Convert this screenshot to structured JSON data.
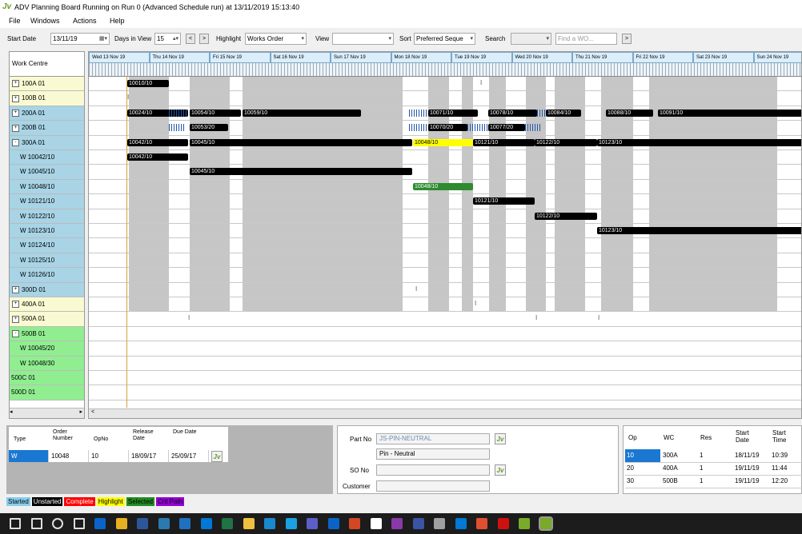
{
  "window": {
    "title": "ADV Planning Board Running on Run 0 (Advanced Schedule run) at 13/11/2019 15:13:40",
    "app_icon": "Jv"
  },
  "menu": [
    "File",
    "Windows",
    "Actions",
    "Help"
  ],
  "toolbar": {
    "start_date_label": "Start Date",
    "start_date": "13/11/19",
    "days_label": "Days in View",
    "days": "15",
    "highlight_label": "Highlight",
    "highlight": "Works Order",
    "view_label": "View",
    "view": "",
    "sort_label": "Sort",
    "sort": "Preferred Seque",
    "search_label": "Search",
    "search": "",
    "find_placeholder": "Find a WO...",
    "prev": "<",
    "next": ">",
    "go": ">"
  },
  "work_centre": {
    "header": "Work Centre",
    "rows": [
      {
        "label": "100A 01",
        "expander": "+",
        "indent": false
      },
      {
        "label": "100B 01",
        "expander": "+",
        "indent": false
      },
      {
        "label": "200A 01",
        "expander": "+",
        "indent": false
      },
      {
        "label": "200B 01",
        "expander": "+",
        "indent": false
      },
      {
        "label": "300A 01",
        "expander": "-",
        "indent": false
      },
      {
        "label": "W 10042/10",
        "expander": "",
        "indent": true
      },
      {
        "label": "W 10045/10",
        "expander": "",
        "indent": true
      },
      {
        "label": "W 10048/10",
        "expander": "",
        "indent": true
      },
      {
        "label": "W 10121/10",
        "expander": "",
        "indent": true
      },
      {
        "label": "W 10122/10",
        "expander": "",
        "indent": true
      },
      {
        "label": "W 10123/10",
        "expander": "",
        "indent": true
      },
      {
        "label": "W 10124/10",
        "expander": "",
        "indent": true
      },
      {
        "label": "W 10125/10",
        "expander": "",
        "indent": true
      },
      {
        "label": "W 10126/10",
        "expander": "",
        "indent": true
      },
      {
        "label": "300D 01",
        "expander": "+",
        "indent": false
      },
      {
        "label": "400A 01",
        "expander": "+",
        "indent": false
      },
      {
        "label": "500A 01",
        "expander": "+",
        "indent": false
      },
      {
        "label": "500B 01",
        "expander": "-",
        "indent": false
      },
      {
        "label": "W 10045/20",
        "expander": "",
        "indent": true
      },
      {
        "label": "W 10048/30",
        "expander": "",
        "indent": true
      },
      {
        "label": "500C 01",
        "expander": "",
        "indent": false
      },
      {
        "label": "500D 01",
        "expander": "",
        "indent": false
      }
    ],
    "colors": [
      "#fafad2",
      "#fafad2",
      "#a8d4e6",
      "#a8d4e6",
      "#a8d4e6",
      "#a8d4e6",
      "#a8d4e6",
      "#a8d4e6",
      "#a8d4e6",
      "#a8d4e6",
      "#a8d4e6",
      "#a8d4e6",
      "#a8d4e6",
      "#a8d4e6",
      "#a8d4e6",
      "#fafad2",
      "#fafad2",
      "#90ee90",
      "#90ee90",
      "#90ee90",
      "#90ee90",
      "#90ee90"
    ]
  },
  "gantt": {
    "days": [
      "Wed 13 Nov 19",
      "Thu 14 Nov 19",
      "Fri 15 Nov 19",
      "Sat 16 Nov 19",
      "Sun 17 Nov 19",
      "Mon 18 Nov 19",
      "Tue 19 Nov 19",
      "Wed 20 Nov 19",
      "Thu 21 Nov 19",
      "Fri 22 Nov 19",
      "Sat 23 Nov 19",
      "Sun 24 Nov 19"
    ],
    "bars": [
      {
        "row": 0,
        "label": "10010/10",
        "color": "black"
      },
      {
        "row": 2,
        "label": "10024/10",
        "color": "black"
      },
      {
        "row": 2,
        "label": "10054/10",
        "color": "black"
      },
      {
        "row": 2,
        "label": "10059/10",
        "color": "black"
      },
      {
        "row": 2,
        "label": "10071/10",
        "color": "black"
      },
      {
        "row": 2,
        "label": "10078/10",
        "color": "black"
      },
      {
        "row": 2,
        "label": "10084/10",
        "color": "black"
      },
      {
        "row": 2,
        "label": "10088/10",
        "color": "black"
      },
      {
        "row": 2,
        "label": "10091/10",
        "color": "black"
      },
      {
        "row": 3,
        "label": "10053/20",
        "color": "black"
      },
      {
        "row": 3,
        "label": "10070/20",
        "color": "black"
      },
      {
        "row": 3,
        "label": "10077/20",
        "color": "black"
      },
      {
        "row": 4,
        "label": "10042/10",
        "color": "black"
      },
      {
        "row": 4,
        "label": "10045/10",
        "color": "black"
      },
      {
        "row": 4,
        "label": "10048/10",
        "color": "yellow"
      },
      {
        "row": 4,
        "label": "10121/10",
        "color": "black"
      },
      {
        "row": 4,
        "label": "10122/10",
        "color": "black"
      },
      {
        "row": 4,
        "label": "10123/10",
        "color": "black"
      },
      {
        "row": 5,
        "label": "10042/10",
        "color": "black"
      },
      {
        "row": 6,
        "label": "10045/10",
        "color": "black"
      },
      {
        "row": 7,
        "label": "10048/10",
        "color": "green"
      },
      {
        "row": 8,
        "label": "10121/10",
        "color": "black"
      },
      {
        "row": 9,
        "label": "10122/10",
        "color": "black"
      },
      {
        "row": 10,
        "label": "10123/10",
        "color": "black"
      }
    ],
    "scroll_left": "<"
  },
  "order": {
    "headers": [
      "Type",
      "Order Number",
      "OpNo",
      "Release Date",
      "Due Date"
    ],
    "row": [
      "W",
      "10048",
      "10",
      "18/09/17",
      "25/09/17"
    ],
    "jv": "Jv"
  },
  "part": {
    "part_no_label": "Part No",
    "part_no": "JS-PIN-NEUTRAL",
    "description": "Pin - Neutral",
    "so_label": "SO No",
    "so_no": "",
    "customer_label": "Customer",
    "customer": "",
    "jv": "Jv"
  },
  "ops": {
    "headers": [
      "Op",
      "WC",
      "Res",
      "Start Date",
      "Start Time"
    ],
    "rows": [
      [
        "10",
        "300A",
        "1",
        "18/11/19",
        "10:39"
      ],
      [
        "20",
        "400A",
        "1",
        "19/11/19",
        "11:44"
      ],
      [
        "30",
        "500B",
        "1",
        "19/11/19",
        "12:20"
      ]
    ]
  },
  "legend": [
    {
      "label": "Started",
      "bg": "#87ceeb",
      "fg": "#000000"
    },
    {
      "label": "Unstarted",
      "bg": "#000000",
      "fg": "#ffffff"
    },
    {
      "label": "Complete",
      "bg": "#ff0000",
      "fg": "#ffffff"
    },
    {
      "label": "Highlight",
      "bg": "#ffff00",
      "fg": "#000000"
    },
    {
      "label": "Selected",
      "bg": "#228b22",
      "fg": "#000000"
    },
    {
      "label": "Crit Path",
      "bg": "#9400d3",
      "fg": "#000000"
    }
  ],
  "taskbar": [
    "start-icon",
    "search-icon",
    "cortana-icon",
    "task-view-icon",
    "outlook-icon",
    "chrome-icon",
    "word-icon",
    "paint-icon",
    "people-icon",
    "mail-icon",
    "excel-icon",
    "folder-icon",
    "edge-icon",
    "ie-icon",
    "teams-icon",
    "photos-icon",
    "powerpoint-icon",
    "help-icon",
    "calendar-icon",
    "visio-icon",
    "sql-icon",
    "mail2-icon",
    "paint2-icon",
    "acrobat-icon",
    "jv-icon",
    "jv-active-icon"
  ]
}
